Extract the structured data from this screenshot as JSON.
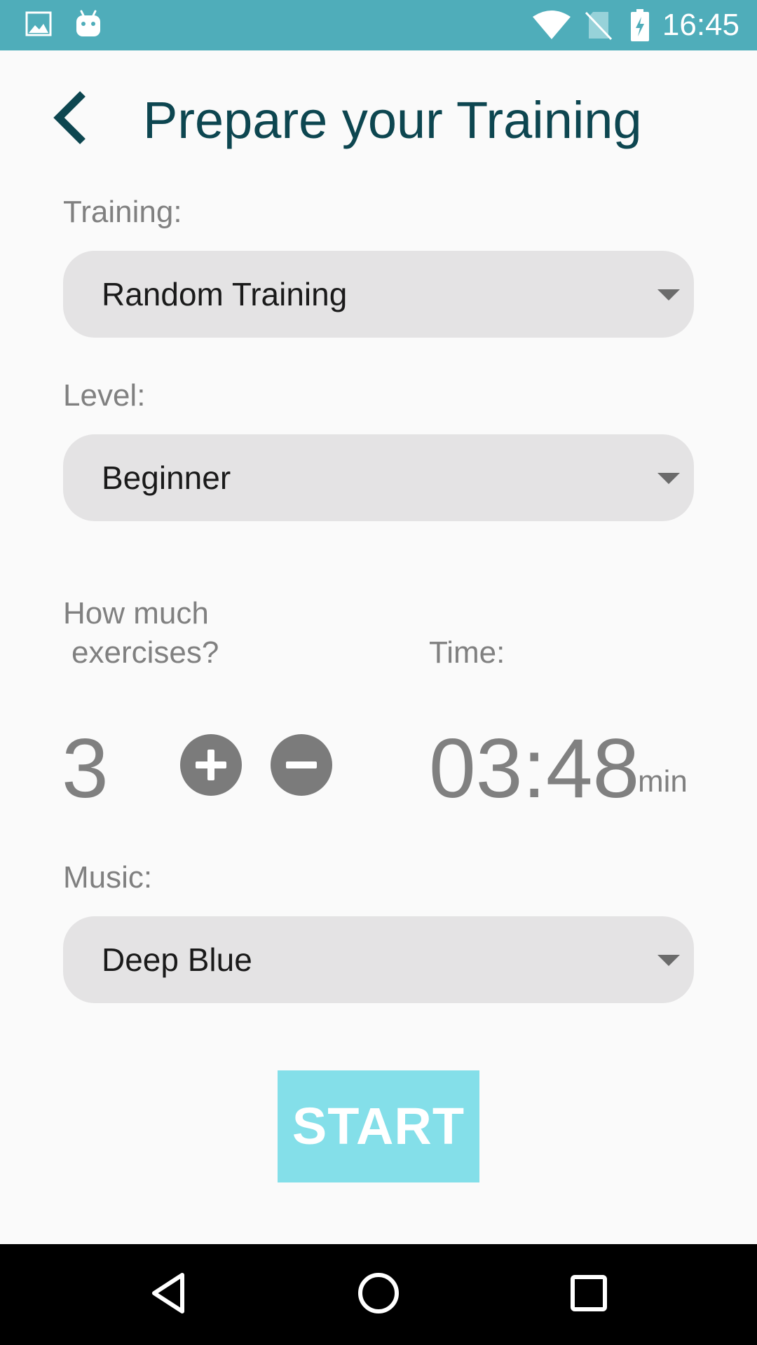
{
  "status_bar": {
    "time": "16:45",
    "icons": [
      "image-icon",
      "android-icon",
      "wifi-icon",
      "no-sim-icon",
      "battery-charging-icon"
    ],
    "background_color": "#4fadba"
  },
  "header": {
    "back_icon": "chevron-left-icon",
    "title": "Prepare your Training"
  },
  "training": {
    "label": "Training:",
    "selected": "Random Training"
  },
  "level": {
    "label": "Level:",
    "selected": "Beginner"
  },
  "exercises": {
    "label_line1": "How much",
    "label_line2": "exercises?",
    "count": "3",
    "increment_icon": "plus-circle-icon",
    "decrement_icon": "minus-circle-icon"
  },
  "time": {
    "label": "Time:",
    "value": "03:48",
    "unit": "min"
  },
  "music": {
    "label": "Music:",
    "selected": "Deep Blue"
  },
  "start_button": {
    "label": "START",
    "color": "#84dfe9"
  },
  "nav_bar": {
    "icons": [
      "back-triangle-icon",
      "home-circle-icon",
      "recents-square-icon"
    ]
  },
  "colors": {
    "title": "#0d4650",
    "label": "#808080",
    "dropdown_bg": "#e4e3e4"
  }
}
